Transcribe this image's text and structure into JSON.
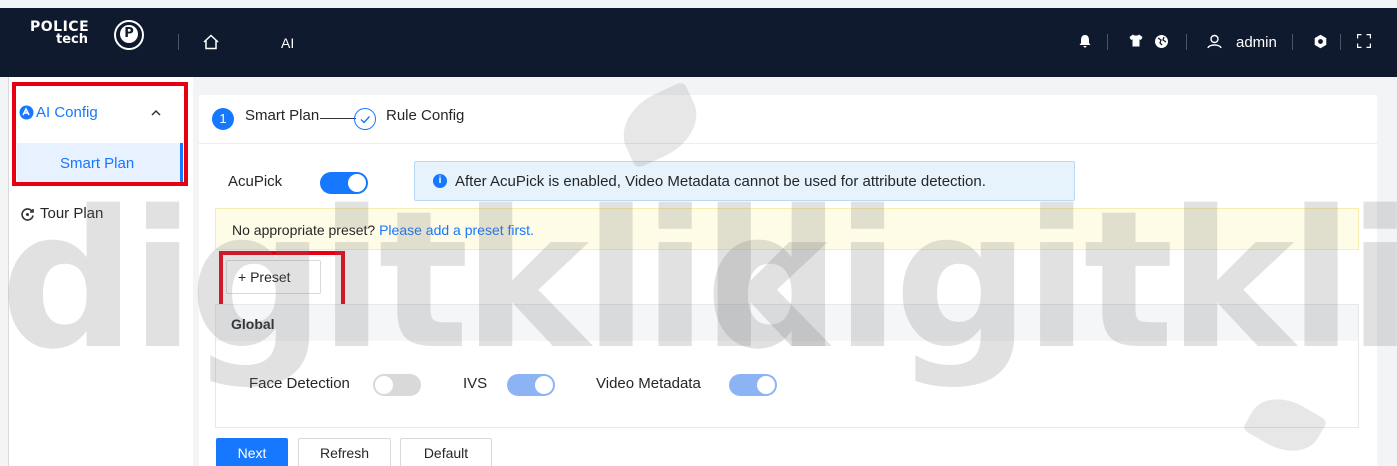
{
  "header": {
    "logo_line1": "POLICE",
    "logo_line2": "tech",
    "title": "AI",
    "user": "admin"
  },
  "sidebar": {
    "items": [
      {
        "label": "AI Config",
        "active": true,
        "children": [
          {
            "label": "Smart Plan",
            "selected": true
          }
        ]
      },
      {
        "label": "Tour Plan"
      }
    ]
  },
  "steps": [
    {
      "number": "1",
      "label": "Smart Plan"
    },
    {
      "label": "Rule Config"
    }
  ],
  "acupick": {
    "label": "AcuPick",
    "enabled": true,
    "info": "After AcuPick is enabled, Video Metadata cannot be used for attribute detection."
  },
  "warning": {
    "text": "No appropriate preset?",
    "link": "Please add a preset first."
  },
  "preset_button": {
    "icon": "+",
    "label": "Preset"
  },
  "global": {
    "title": "Global",
    "features": [
      {
        "label": "Face Detection",
        "enabled": false
      },
      {
        "label": "IVS",
        "enabled": true
      },
      {
        "label": "Video Metadata",
        "enabled": true
      }
    ]
  },
  "buttons": {
    "next": "Next",
    "refresh": "Refresh",
    "default": "Default"
  },
  "watermark": "digitklik",
  "colors": {
    "primary": "#1677ff",
    "topbar": "#0f1a2e",
    "highlight": "#e60012",
    "warning_bg": "#fefbe6"
  }
}
